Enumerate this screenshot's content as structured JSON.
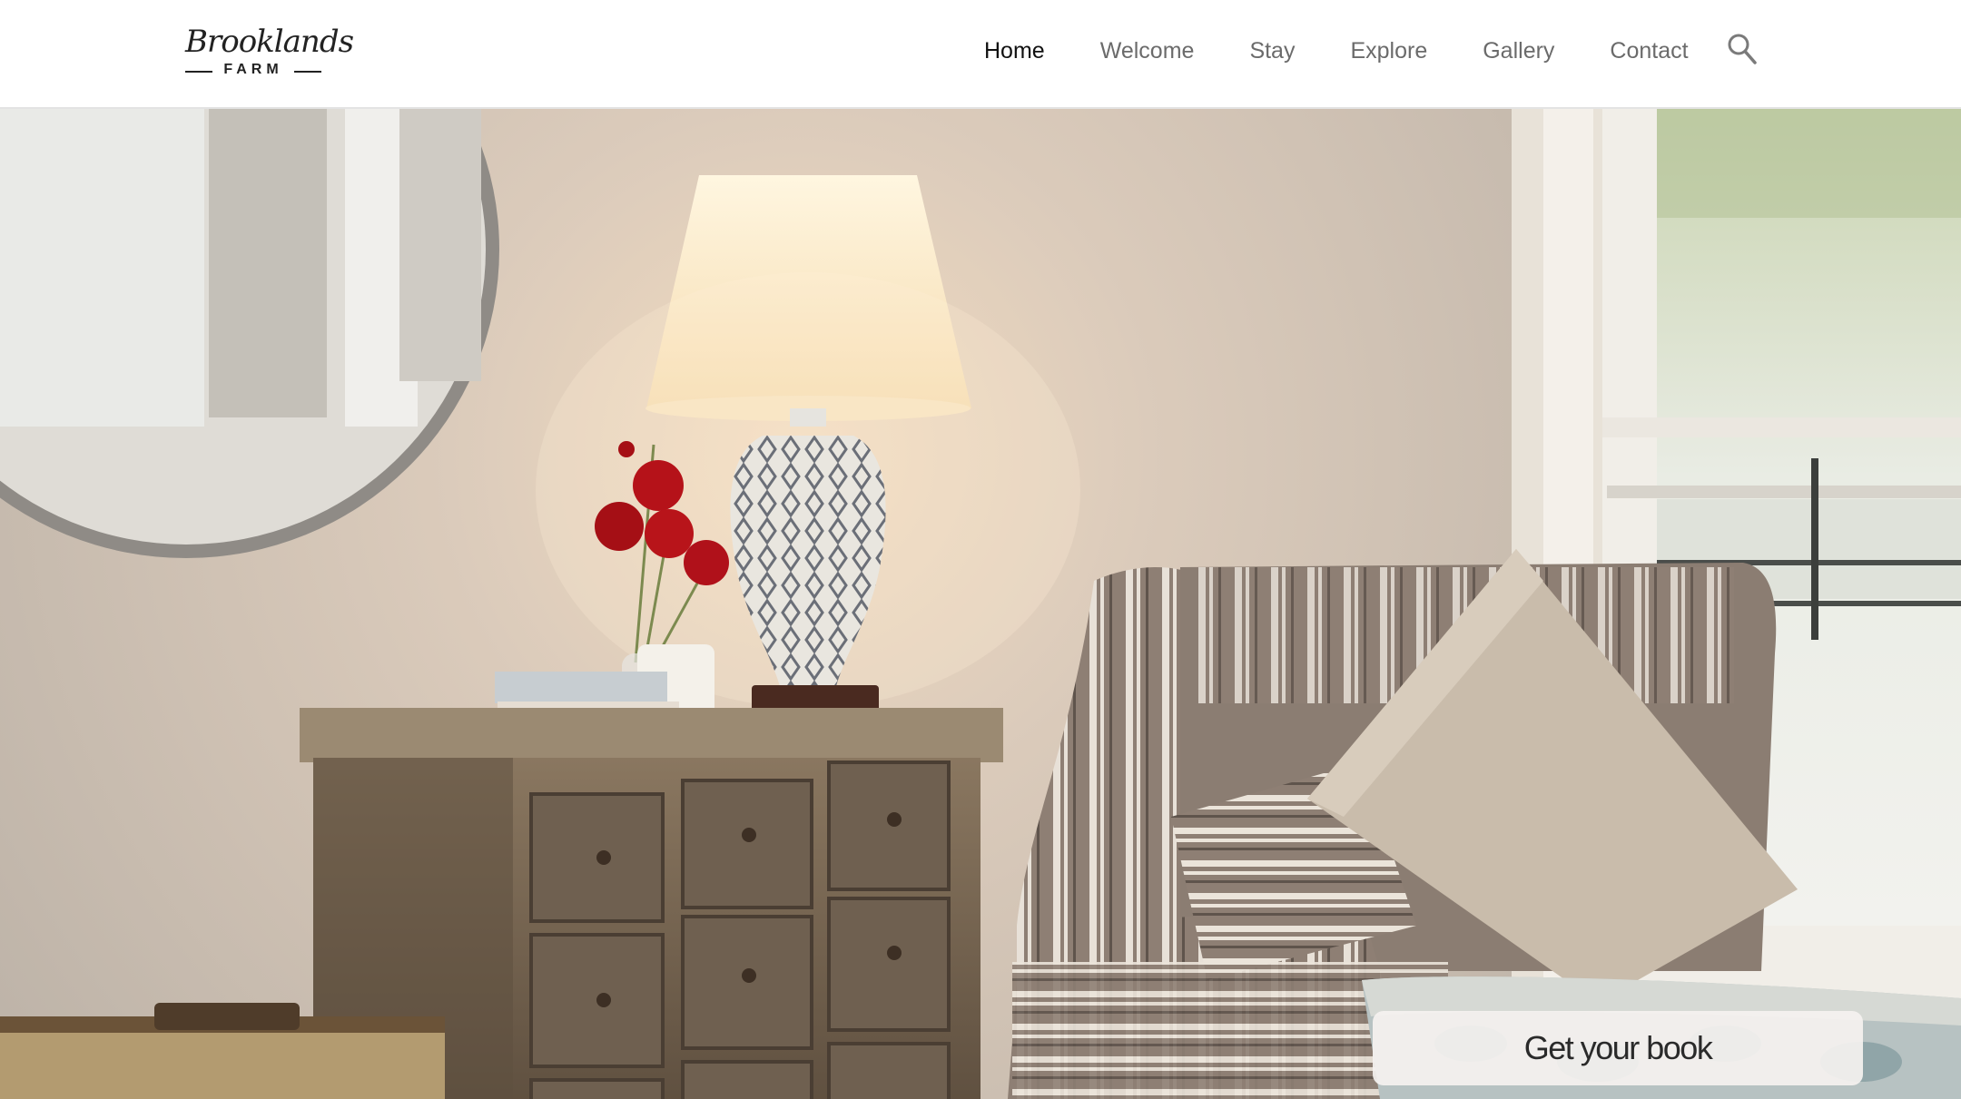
{
  "logo": {
    "script": "Brooklands",
    "word": "FARM"
  },
  "nav": {
    "items": [
      {
        "label": "Home",
        "active": true
      },
      {
        "label": "Welcome",
        "active": false
      },
      {
        "label": "Stay",
        "active": false
      },
      {
        "label": "Explore",
        "active": false
      },
      {
        "label": "Gallery",
        "active": false
      },
      {
        "label": "Contact",
        "active": false
      }
    ],
    "search_icon": "search-icon"
  },
  "hero": {
    "image": "living-room-interior-photo",
    "cta_label": "Get your book"
  },
  "colors": {
    "accent_text": "#111111",
    "nav_text": "#6b6b6b",
    "header_bg": "#ffffff"
  }
}
